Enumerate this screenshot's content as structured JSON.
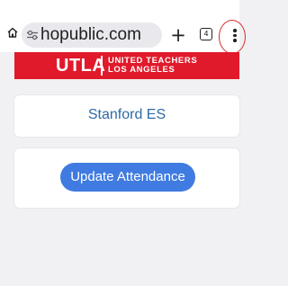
{
  "browser": {
    "url": "hopublic.com",
    "new_tab_label": "+",
    "tab_count": "4",
    "icons": [
      "home-icon",
      "site-settings-icon",
      "tab-switcher-icon",
      "more-menu-icon"
    ]
  },
  "banner": {
    "logo": "UTLA",
    "tag_line1": "UNITED TEACHERS",
    "tag_line2": "LOS ANGELES",
    "color": "#e11a2b"
  },
  "school": {
    "name": "Stanford ES"
  },
  "actions": {
    "update_label": "Update Attendance",
    "button_color": "#3f7be0"
  }
}
